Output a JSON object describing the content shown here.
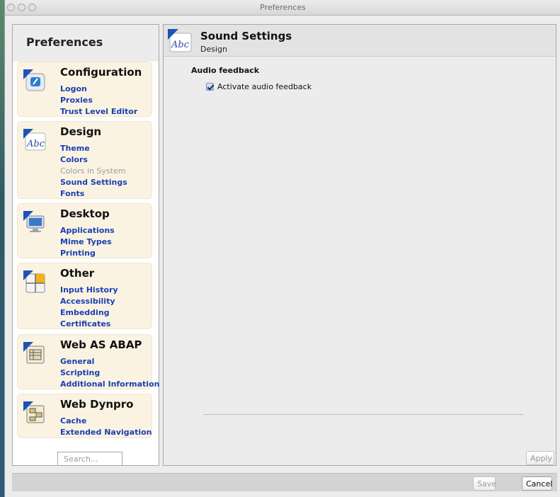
{
  "window": {
    "title": "Preferences"
  },
  "sidebar": {
    "title": "Preferences",
    "search_placeholder": "Search...",
    "groups": [
      {
        "title": "Configuration",
        "icon": "configuration-icon",
        "links": [
          {
            "label": "Logon"
          },
          {
            "label": "Proxies"
          },
          {
            "label": "Trust Level Editor"
          }
        ]
      },
      {
        "title": "Design",
        "icon": "design-icon",
        "links": [
          {
            "label": "Theme"
          },
          {
            "label": "Colors"
          },
          {
            "label": "Colors in System"
          },
          {
            "label": "Sound Settings"
          },
          {
            "label": "Fonts"
          }
        ]
      },
      {
        "title": "Desktop",
        "icon": "desktop-icon",
        "links": [
          {
            "label": "Applications"
          },
          {
            "label": "Mime Types"
          },
          {
            "label": "Printing"
          }
        ]
      },
      {
        "title": "Other",
        "icon": "other-icon",
        "links": [
          {
            "label": "Input History"
          },
          {
            "label": "Accessibility"
          },
          {
            "label": "Embedding"
          },
          {
            "label": "Certificates"
          }
        ]
      },
      {
        "title": "Web AS ABAP",
        "icon": "web-as-abap-icon",
        "links": [
          {
            "label": "General"
          },
          {
            "label": "Scripting"
          },
          {
            "label": "Additional Information"
          }
        ]
      },
      {
        "title": "Web Dynpro",
        "icon": "web-dynpro-icon",
        "links": [
          {
            "label": "Cache"
          },
          {
            "label": "Extended Navigation"
          }
        ]
      }
    ]
  },
  "content": {
    "title": "Sound Settings",
    "subtitle": "Design",
    "icon_text": "Abc",
    "section_label": "Audio feedback",
    "checkbox": {
      "label": "Activate audio feedback",
      "checked": true
    },
    "apply_label": "Apply"
  },
  "footer": {
    "save_label": "Save",
    "cancel_label": "Cancel"
  }
}
